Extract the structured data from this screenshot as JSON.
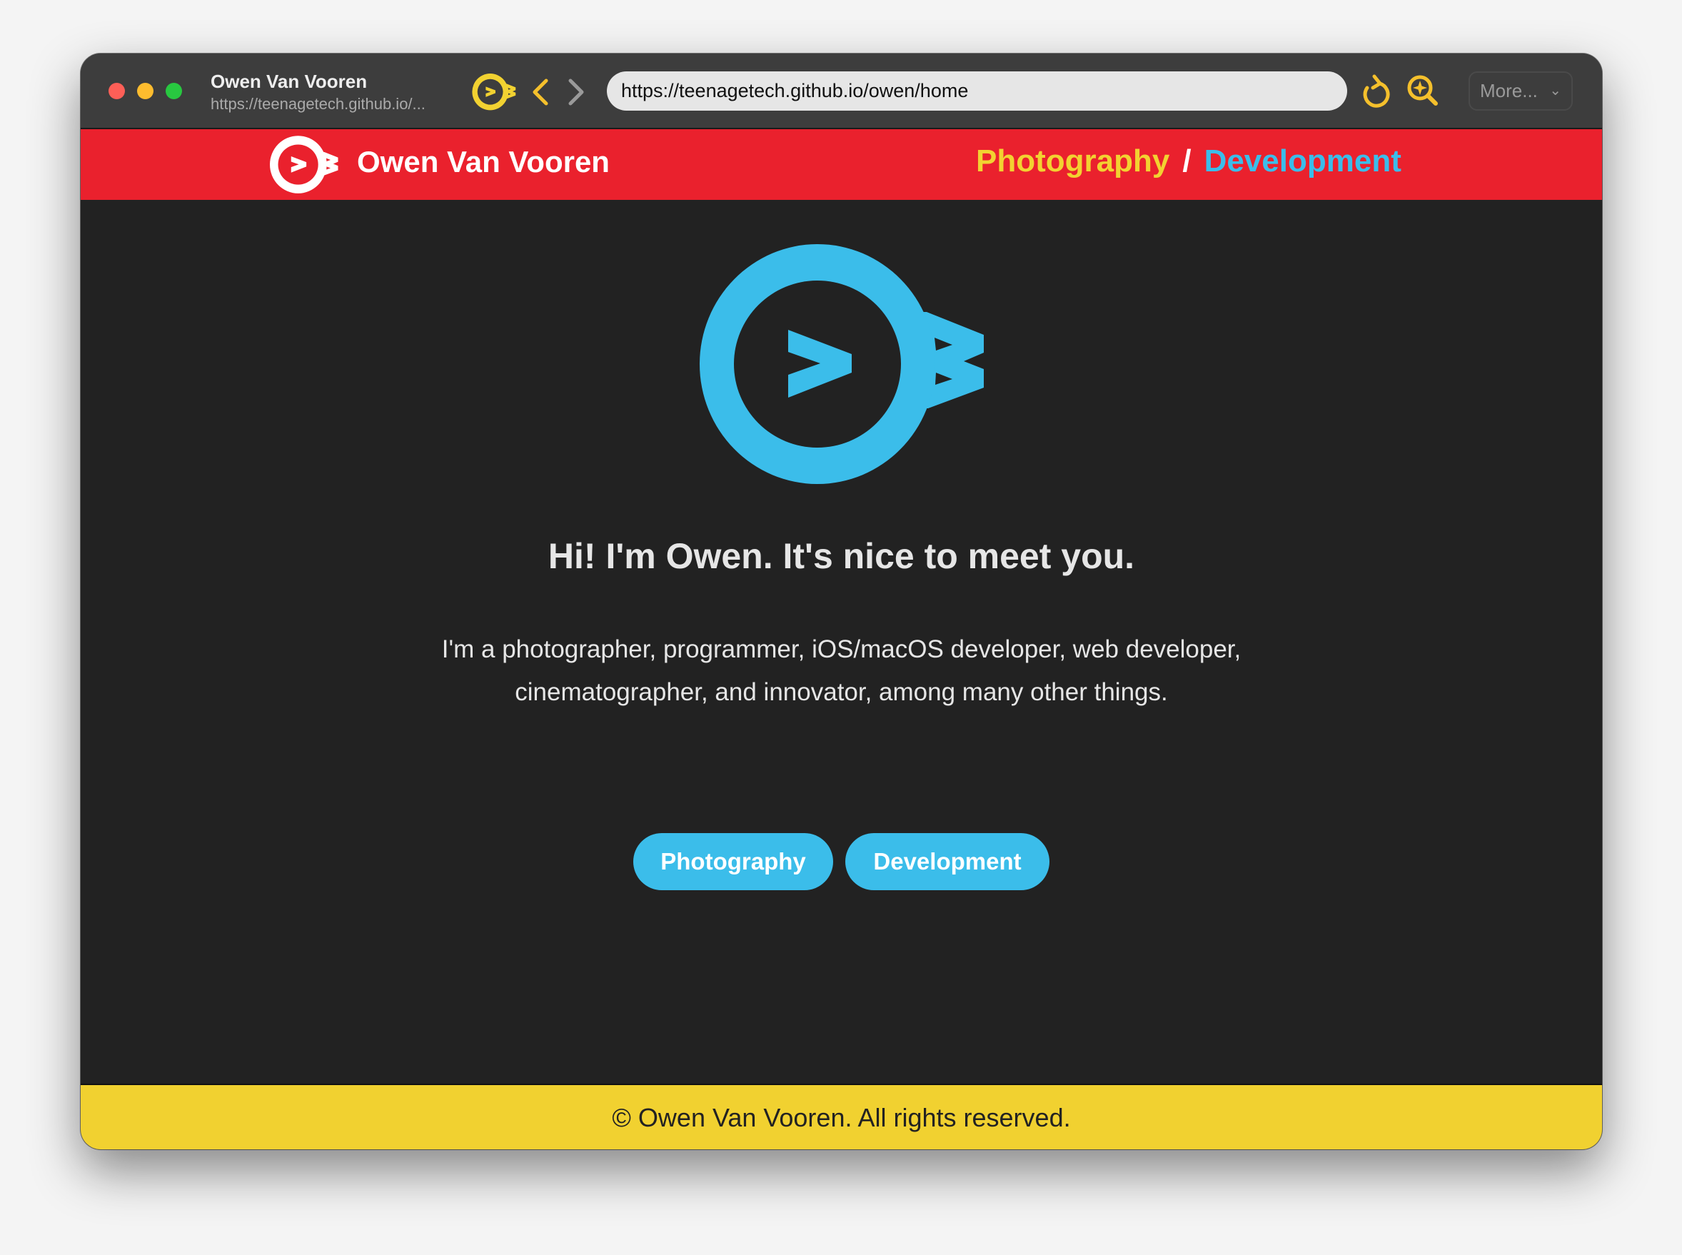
{
  "browser": {
    "tab_title": "Owen Van Vooren",
    "tab_subtitle": "https://teenagetech.github.io/...",
    "url": "https://teenagetech.github.io/owen/home",
    "more_label": "More...",
    "accent": "#f5c02c"
  },
  "header": {
    "title": "Owen Van Vooren",
    "nav": {
      "photography": "Photography",
      "separator": "/",
      "development": "Development"
    },
    "bg_color": "#ea212d"
  },
  "main": {
    "heading": "Hi! I'm Owen. It's nice to meet you.",
    "paragraph_line1": "I'm a photographer, programmer, iOS/macOS developer, web developer,",
    "paragraph_line2": "cinematographer, and innovator, among many other things.",
    "buttons": {
      "photography": "Photography",
      "development": "Development"
    },
    "accent": "#3bbdea"
  },
  "footer": {
    "text": "© Owen Van Vooren. All rights reserved.",
    "bg_color": "#f1d130"
  }
}
